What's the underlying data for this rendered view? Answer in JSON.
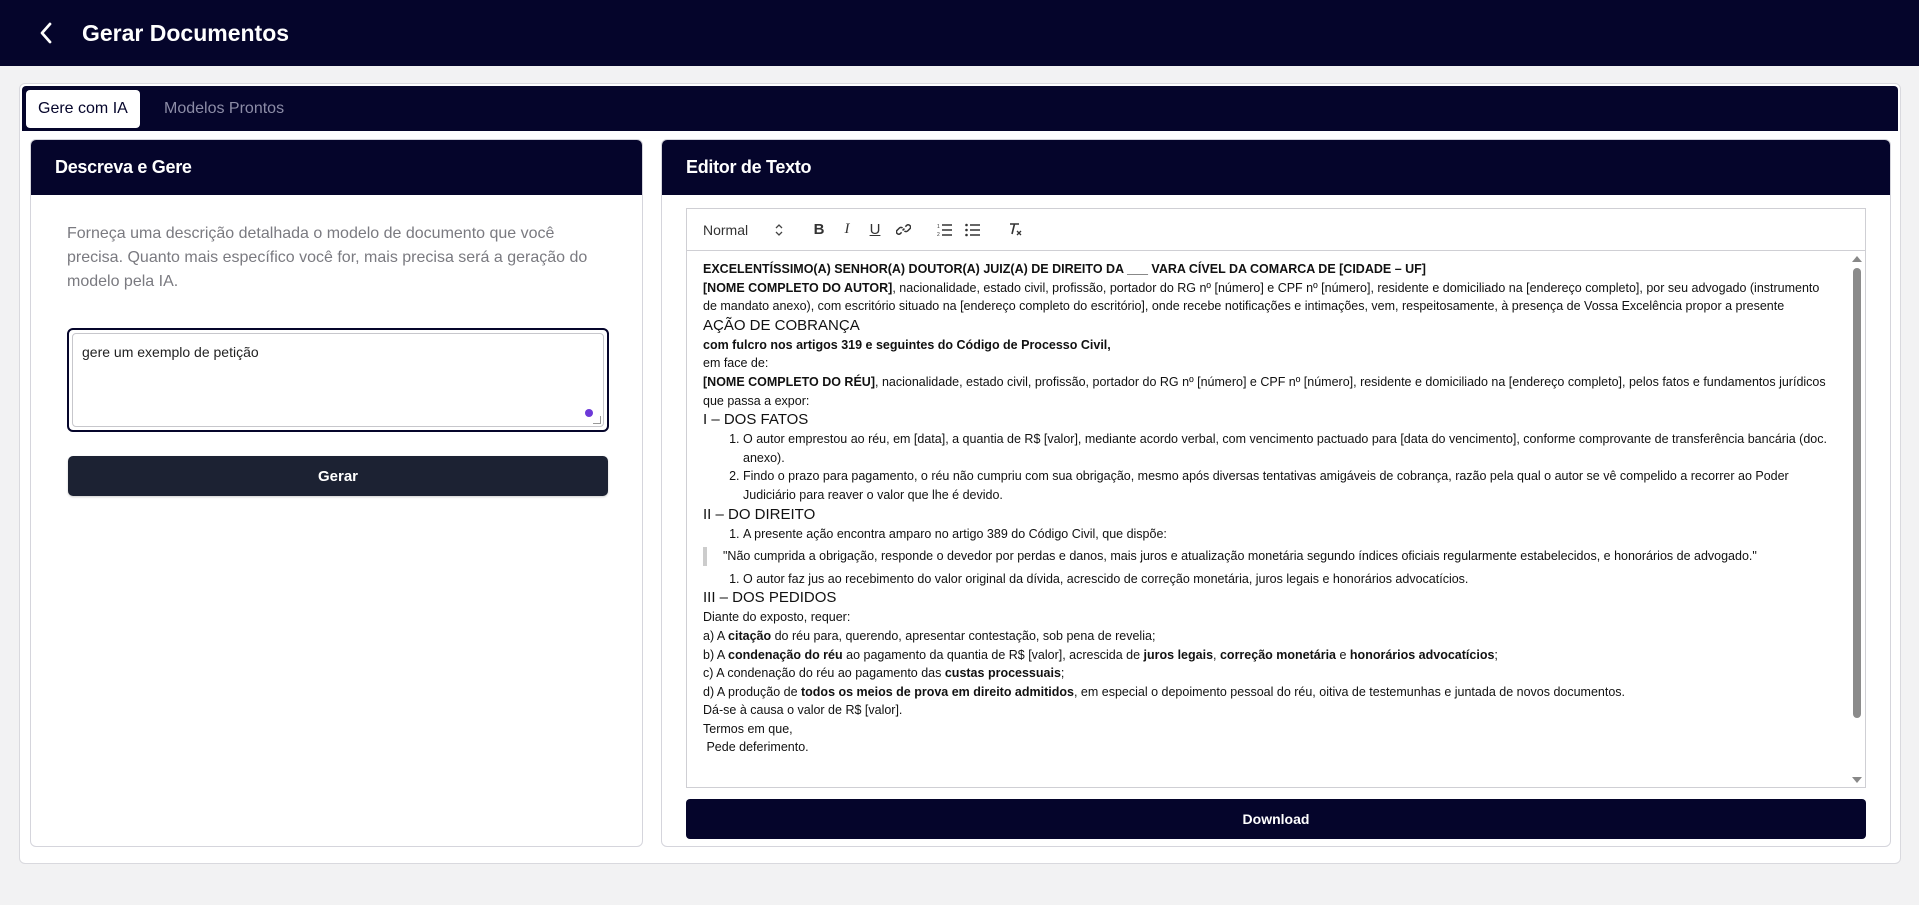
{
  "header": {
    "title": "Gerar Documentos",
    "back_icon": "chevron-left-icon"
  },
  "tabs": [
    {
      "label": "Gere com IA",
      "active": true
    },
    {
      "label": "Modelos Prontos",
      "active": false
    }
  ],
  "left_panel": {
    "title": "Descreva e Gere",
    "description": "Forneça uma descrição detalhada o modelo de documento que você precisa. Quanto mais específico você for, mais precisa será a geração do modelo pela IA.",
    "prompt_value": "gere um exemplo de petição",
    "generate_label": "Gerar"
  },
  "right_panel": {
    "title": "Editor de Texto",
    "toolbar": {
      "format_select": "Normal",
      "icons": [
        "bold-icon",
        "italic-icon",
        "underline-icon",
        "link-icon",
        "ordered-list-icon",
        "bullet-list-icon",
        "clear-format-icon"
      ]
    },
    "download_label": "Download",
    "document": {
      "heading": "EXCELENTÍSSIMO(A) SENHOR(A) DOUTOR(A) JUIZ(A) DE DIREITO DA ___ VARA CÍVEL DA COMARCA DE [CIDADE – UF]",
      "author_name": "[NOME COMPLETO DO AUTOR]",
      "author_text": ", nacionalidade, estado civil, profissão, portador do RG nº [número] e CPF nº [número], residente e domiciliado na [endereço completo], por seu advogado (instrumento de mandato anexo), com escritório situado na [endereço completo do escritório], onde recebe notificações e intimações, vem, respeitosamente, à presença de Vossa Excelência propor a presente",
      "action_title": "AÇÃO DE COBRANÇA",
      "legal_basis": "com fulcro nos artigos 319 e seguintes do Código de Processo Civil,",
      "face": "em face de:",
      "defendant_name": "[NOME COMPLETO DO RÉU]",
      "defendant_text": ", nacionalidade, estado civil, profissão, portador do RG nº [número] e CPF nº [número], residente e domiciliado na [endereço completo], pelos fatos e fundamentos jurídicos que passa a expor:",
      "section1": "I – DOS FATOS",
      "facts": [
        "O autor emprestou ao réu, em [data], a quantia de R$ [valor], mediante acordo verbal, com vencimento pactuado para [data do vencimento], conforme comprovante de transferência bancária (doc. anexo).",
        "Findo o prazo para pagamento, o réu não cumpriu com sua obrigação, mesmo após diversas tentativas amigáveis de cobrança, razão pela qual o autor se vê compelido a recorrer ao Poder Judiciário para reaver o valor que lhe é devido."
      ],
      "section2": "II – DO DIREITO",
      "law1": "A presente ação encontra amparo no artigo 389 do Código Civil, que dispõe:",
      "quote": "\"Não cumprida a obrigação, responde o devedor por perdas e danos, mais juros e atualização monetária segundo índices oficiais regularmente estabelecidos, e honorários de advogado.\"",
      "law2": "O autor faz jus ao recebimento do valor original da dívida, acrescido de correção monetária, juros legais e honorários advocatícios.",
      "section3": "III – DOS PEDIDOS",
      "requests_intro": "Diante do exposto, requer:",
      "req_a": {
        "pre": "a) A ",
        "b1": "citação",
        "post": " do réu para, querendo, apresentar contestação, sob pena de revelia;"
      },
      "req_b": {
        "pre": "b) A ",
        "b1": "condenação do réu",
        "mid1": " ao pagamento da quantia de R$ [valor], acrescida de ",
        "b2": "juros legais",
        "mid2": ", ",
        "b3": "correção monetária",
        "mid3": " e ",
        "b4": "honorários advocatícios",
        "post": ";"
      },
      "req_c": {
        "pre": "c) A condenação do réu ao pagamento das ",
        "b1": "custas processuais",
        "post": ";"
      },
      "req_d": {
        "pre": "d) A produção de ",
        "b1": "todos os meios de prova em direito admitidos",
        "post": ", em especial o depoimento pessoal do réu, oitiva de testemunhas e juntada de novos documentos."
      },
      "value": "Dá-se à causa o valor de R$ [valor].",
      "closing1": "Termos em que,",
      "closing2": " Pede deferimento."
    }
  }
}
